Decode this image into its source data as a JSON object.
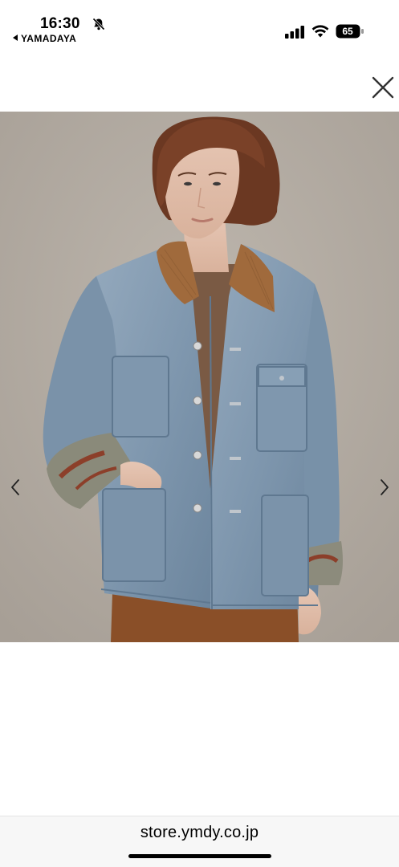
{
  "status_bar": {
    "time": "16:30",
    "back_app": "YAMADAYA",
    "battery": "65",
    "icons": [
      "bell-slash-icon",
      "signal-icon",
      "wifi-icon",
      "battery-icon"
    ]
  },
  "viewer": {
    "close_icon": "close-icon",
    "prev_icon": "chevron-left-icon",
    "next_icon": "chevron-right-icon"
  },
  "browser": {
    "url": "store.ymdy.co.jp"
  },
  "colors": {
    "background": "#b4ada4",
    "denim": "#7f97ae",
    "corduroy": "#a06a3c",
    "skirt": "#8a4f28"
  }
}
